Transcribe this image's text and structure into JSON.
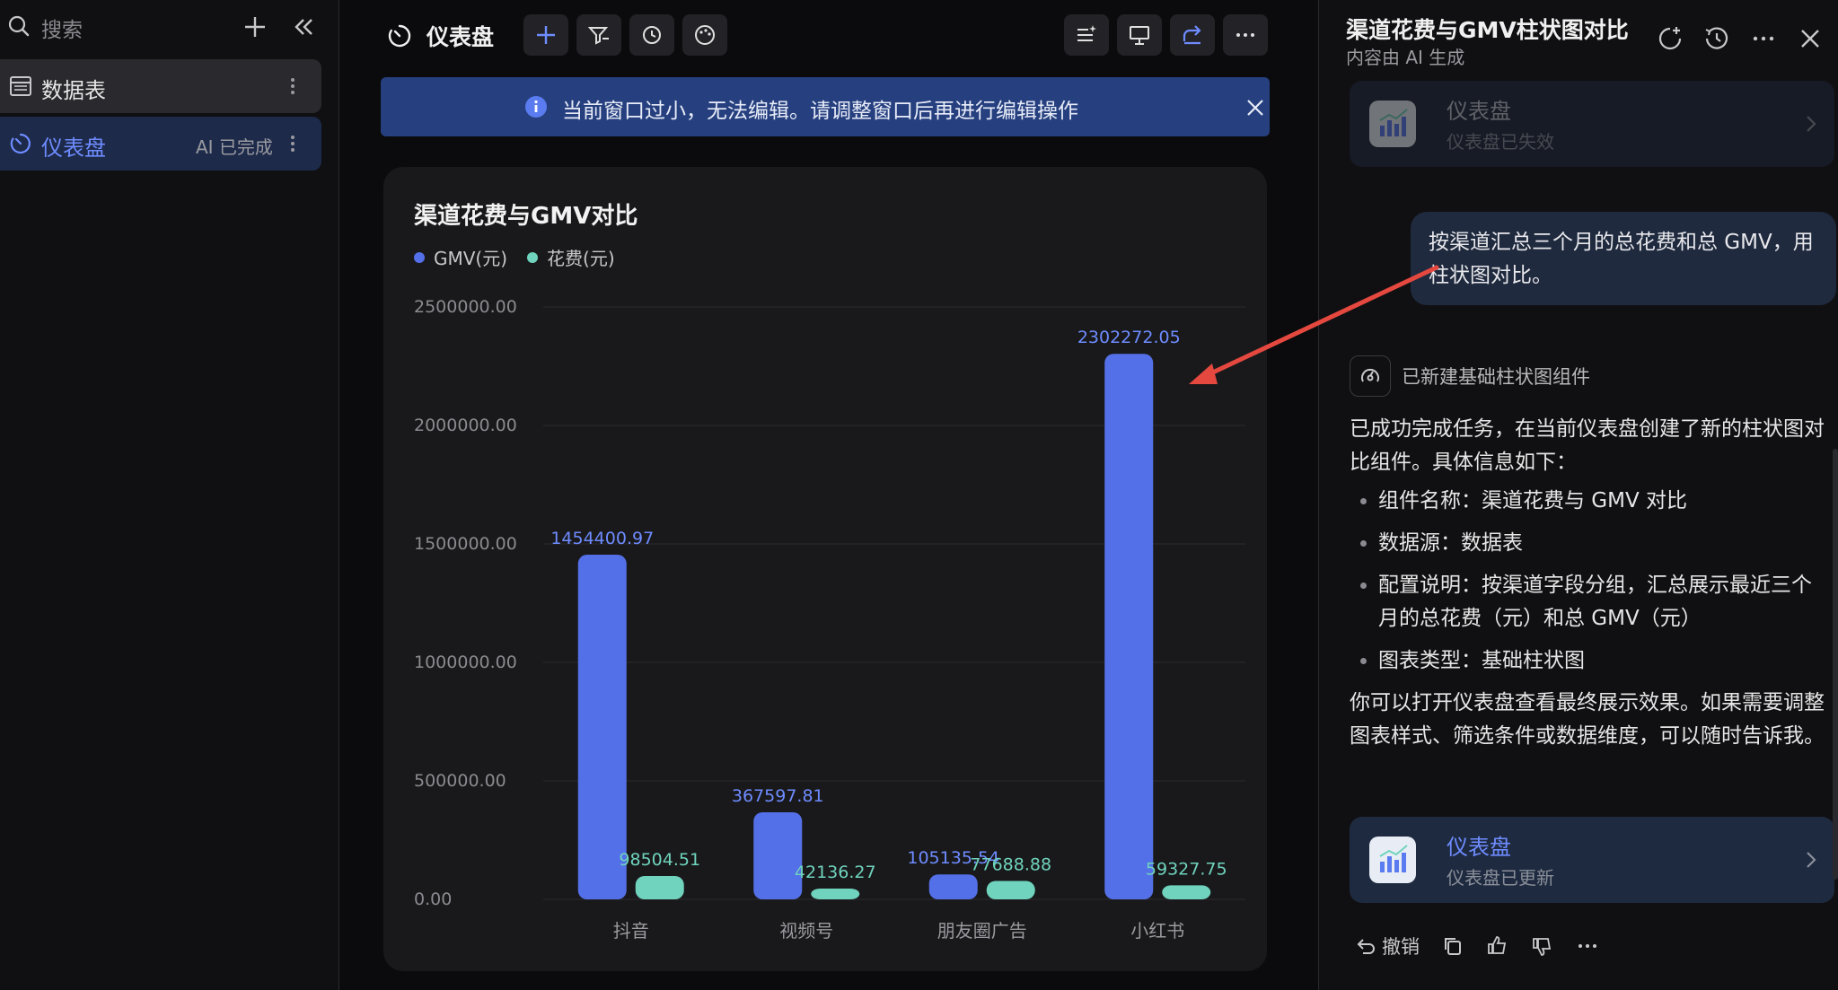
{
  "sidebar": {
    "search_placeholder": "搜索",
    "items": [
      {
        "label": "数据表",
        "badge": ""
      },
      {
        "label": "仪表盘",
        "badge": "AI 已完成"
      }
    ]
  },
  "main": {
    "title": "仪表盘",
    "banner": "当前窗口过小，无法编辑。请调整窗口后再进行编辑操作"
  },
  "chart_data": {
    "type": "bar",
    "title": "渠道花费与GMV对比",
    "categories": [
      "抖音",
      "视频号",
      "朋友圈广告",
      "小红书"
    ],
    "series": [
      {
        "name": "GMV(元)",
        "color": "#5470e8",
        "values": [
          1454400.97,
          367597.81,
          105135.54,
          2302272.05
        ],
        "labels": [
          "1454400.97",
          "367597.81",
          "105135.54",
          "2302272.05"
        ]
      },
      {
        "name": "花费(元)",
        "color": "#6fd3bd",
        "values": [
          98504.51,
          42136.27,
          77688.88,
          59327.75
        ],
        "labels": [
          "98504.51",
          "42136.27",
          "77688.88",
          "59327.75"
        ]
      }
    ],
    "yticks": [
      "0.00",
      "500000.00",
      "1000000.00",
      "1500000.00",
      "2000000.00",
      "2500000.00"
    ],
    "ylim": [
      0,
      2500000
    ],
    "grid": true,
    "legend_position": "top-left"
  },
  "panel": {
    "title": "渠道花费与GMV柱状图对比",
    "subtitle": "内容由 AI 生成",
    "card_old": {
      "title": "仪表盘",
      "subtitle": "仪表盘已失效"
    },
    "user_message": "按渠道汇总三个月的总花费和总 GMV，用柱状图对比。",
    "status": "已新建基础柱状图组件",
    "response_intro": "已成功完成任务，在当前仪表盘创建了新的柱状图对比组件。具体信息如下：",
    "bullets": [
      "组件名称：渠道花费与 GMV 对比",
      "数据源：数据表",
      "配置说明：按渠道字段分组，汇总展示最近三个月的总花费（元）和总 GMV（元）",
      "图表类型：基础柱状图"
    ],
    "response_outro": "你可以打开仪表盘查看最终展示效果。如果需要调整图表样式、筛选条件或数据维度，可以随时告诉我。",
    "card_new": {
      "title": "仪表盘",
      "subtitle": "仪表盘已更新"
    },
    "undo_label": "撤销"
  }
}
